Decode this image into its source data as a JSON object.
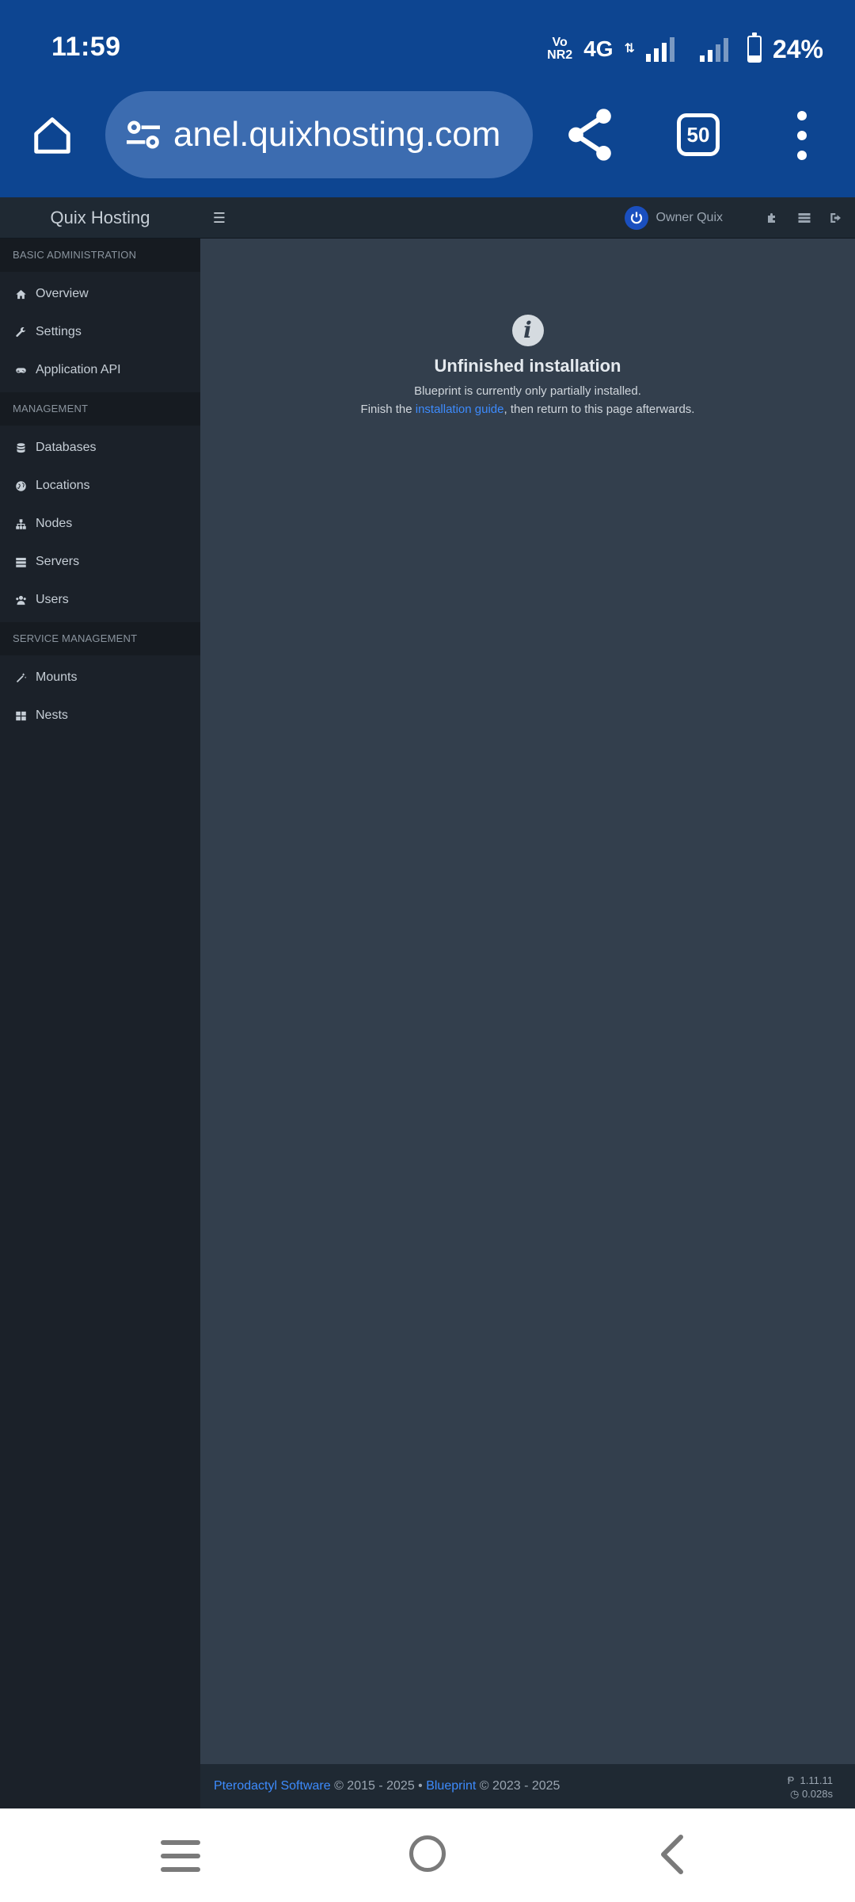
{
  "status_bar": {
    "time": "11:59",
    "volte": [
      "Vo",
      "NR2"
    ],
    "network": "4G",
    "arrows": "⇅",
    "battery_level": 0.24,
    "battery_percent": "24%"
  },
  "browser": {
    "url": "anel.quixhosting.com",
    "tab_count": "50"
  },
  "topbar": {
    "brand": "Quix Hosting",
    "user_name": "Owner Quix"
  },
  "sidebar": {
    "sections": [
      {
        "header": "BASIC ADMINISTRATION",
        "items": [
          {
            "label": "Overview",
            "icon": "home-icon"
          },
          {
            "label": "Settings",
            "icon": "wrench-icon"
          },
          {
            "label": "Application API",
            "icon": "gamepad-icon"
          }
        ]
      },
      {
        "header": "MANAGEMENT",
        "items": [
          {
            "label": "Databases",
            "icon": "database-icon"
          },
          {
            "label": "Locations",
            "icon": "globe-icon"
          },
          {
            "label": "Nodes",
            "icon": "sitemap-icon"
          },
          {
            "label": "Servers",
            "icon": "server-icon"
          },
          {
            "label": "Users",
            "icon": "users-icon"
          }
        ]
      },
      {
        "header": "SERVICE MANAGEMENT",
        "items": [
          {
            "label": "Mounts",
            "icon": "magic-icon"
          },
          {
            "label": "Nests",
            "icon": "th-large-icon"
          }
        ]
      }
    ]
  },
  "notice": {
    "icon": "info-icon",
    "title": "Unfinished installation",
    "line1": "Blueprint is currently only partially installed.",
    "line2_before": "Finish the ",
    "line2_link": "installation guide",
    "line2_after": ", then return to this page afterwards."
  },
  "footer": {
    "pterodactyl_link": "Pterodactyl Software",
    "pterodactyl_years": " © 2015 - 2025 • ",
    "blueprint_link": "Blueprint",
    "blueprint_years": " © 2023 - 2025",
    "version": "1.11.11",
    "time": "0.028s"
  },
  "colors": {
    "browser_chrome": "#0d4591",
    "content_bg": "#333f4d",
    "sidebar_bg": "#1b2129",
    "link": "#3d8bfd"
  }
}
